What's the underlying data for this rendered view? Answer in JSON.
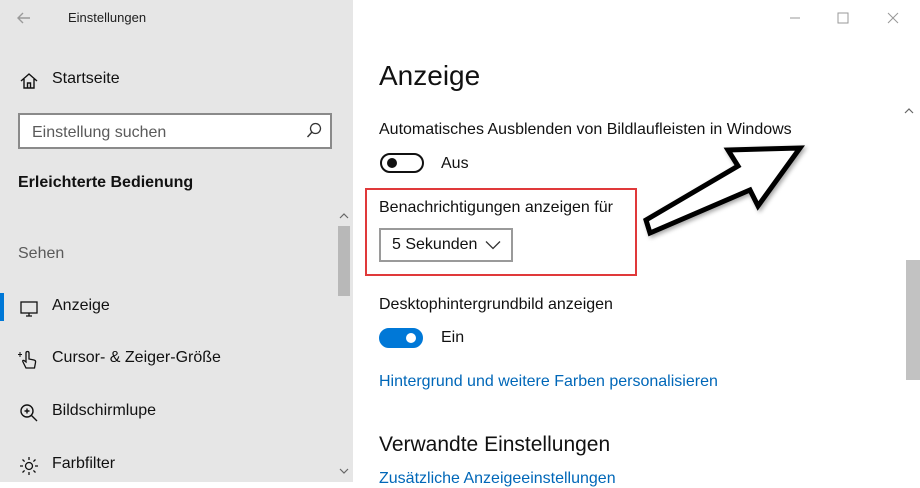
{
  "window": {
    "title": "Einstellungen",
    "back_icon": "back-arrow-icon",
    "controls": [
      "minimize-icon",
      "maximize-icon",
      "close-icon"
    ]
  },
  "sidebar": {
    "home_label": "Startseite",
    "home_icon": "home-icon",
    "search_placeholder": "Einstellung suchen",
    "search_icon": "search-icon",
    "current_section": "Erleichterte Bedienung",
    "group_label": "Sehen",
    "items": [
      {
        "label": "Anzeige",
        "icon": "monitor-icon",
        "active": true
      },
      {
        "label": "Cursor- & Zeiger-Größe",
        "icon": "cursor-hand-icon",
        "active": false
      },
      {
        "label": "Bildschirmlupe",
        "icon": "magnifier-icon",
        "active": false
      },
      {
        "label": "Farbfilter",
        "icon": "color-filter-icon",
        "active": false
      }
    ]
  },
  "main": {
    "title": "Anzeige",
    "autohide": {
      "label": "Automatisches Ausblenden von Bildlaufleisten in Windows",
      "state_label": "Aus",
      "on": false
    },
    "notify": {
      "label": "Benachrichtigungen anzeigen für",
      "value": "5 Sekunden"
    },
    "wallpaper": {
      "label": "Desktophintergrundbild anzeigen",
      "state_label": "Ein",
      "on": true
    },
    "personalize_link": "Hintergrund und weitere Farben personalisieren",
    "related_heading": "Verwandte Einstellungen",
    "related_link": "Zusätzliche Anzeigeeinstellungen"
  },
  "colors": {
    "accent": "#0078d7",
    "link": "#0067b8",
    "highlight": "#e0393a",
    "sidebar_bg": "#e6e6e6"
  }
}
